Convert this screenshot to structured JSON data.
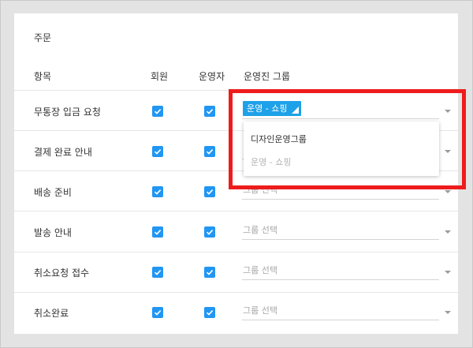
{
  "section": {
    "title": "주문"
  },
  "columns": {
    "item": "항목",
    "member": "회원",
    "operator": "운영자",
    "operator_group": "운영진 그룹"
  },
  "rows": [
    {
      "label": "무통장 입금 요청",
      "member_checked": true,
      "operator_checked": true,
      "group": "운영 - 쇼핑",
      "group_placeholder": ""
    },
    {
      "label": "결제 완료 안내",
      "member_checked": true,
      "operator_checked": true,
      "group": "",
      "group_placeholder": ""
    },
    {
      "label": "배송 준비",
      "member_checked": true,
      "operator_checked": true,
      "group": "",
      "group_placeholder": "그룹 선택"
    },
    {
      "label": "발송 안내",
      "member_checked": true,
      "operator_checked": true,
      "group": "",
      "group_placeholder": "그룹 선택"
    },
    {
      "label": "취소요청 접수",
      "member_checked": true,
      "operator_checked": true,
      "group": "",
      "group_placeholder": "그룹 선택"
    },
    {
      "label": "취소완료",
      "member_checked": true,
      "operator_checked": true,
      "group": "",
      "group_placeholder": "그룹 선택"
    }
  ],
  "dropdown": {
    "options": [
      {
        "label": "디자인운영그룹",
        "selected": false
      },
      {
        "label": "운영 - 쇼핑",
        "selected": true
      }
    ]
  },
  "colors": {
    "accent": "#2196f3",
    "chip": "#1ea1e8",
    "highlight": "#ee1c1c",
    "background": "#e3e3e3"
  },
  "icons": {
    "checkbox": "check-icon",
    "dropdown_caret": "caret-down-icon"
  }
}
